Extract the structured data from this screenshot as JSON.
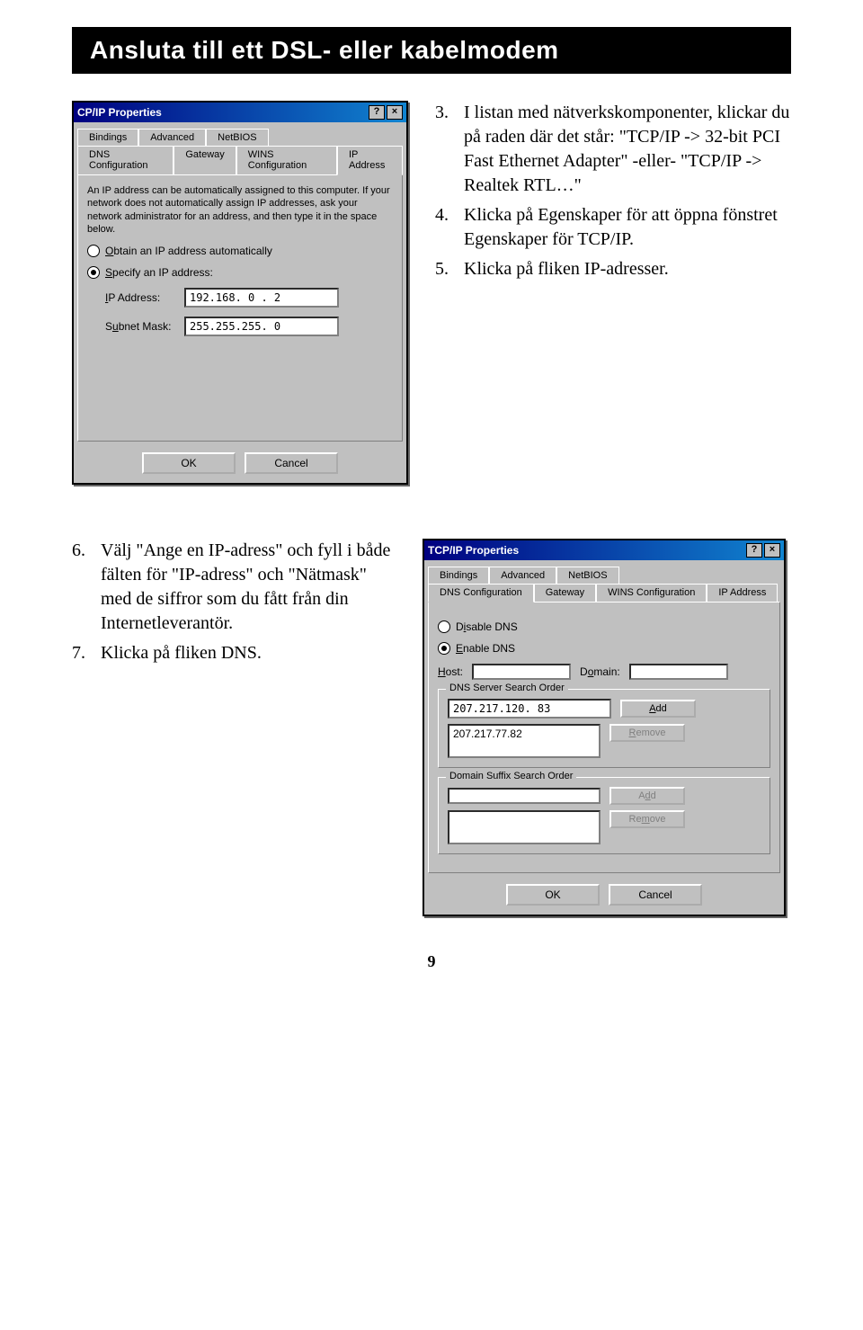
{
  "header": {
    "title": "Ansluta till ett DSL- eller kabelmodem"
  },
  "dialog1": {
    "title": "CP/IP Properties",
    "tabs_top": [
      "Bindings",
      "Advanced",
      "NetBIOS"
    ],
    "tabs_bottom": [
      "DNS Configuration",
      "Gateway",
      "WINS Configuration",
      "IP Address"
    ],
    "help_text": "An IP address can be automatically assigned to this computer. If your network does not automatically assign IP addresses, ask your network administrator for an address, and then type it in the space below.",
    "radio_obtain": "Obtain an IP address automatically",
    "radio_specify": "Specify an IP address:",
    "ip_label": "IP Address:",
    "ip_value": "192.168. 0 . 2",
    "mask_label": "Subnet Mask:",
    "mask_value": "255.255.255. 0",
    "ok": "OK",
    "cancel": "Cancel"
  },
  "instructions1": {
    "items": [
      {
        "n": "3.",
        "text": "I listan med nätverkskomponenter, klickar du på raden där det står: \"TCP/IP -> 32-bit PCI Fast Ethernet Adapter\" -eller- \"TCP/IP -> Realtek RTL…\""
      },
      {
        "n": "4.",
        "text": "Klicka på Egenskaper för att öppna fönstret Egenskaper för TCP/IP."
      },
      {
        "n": "5.",
        "text": "Klicka på fliken IP-adresser."
      }
    ]
  },
  "instructions2": {
    "items": [
      {
        "n": "6.",
        "text": "Välj \"Ange en IP-adress\" och fyll i både fälten för \"IP-adress\" och \"Nätmask\" med de siffror som du fått från din Internetleverantör."
      },
      {
        "n": "7.",
        "text": "Klicka på fliken DNS."
      }
    ]
  },
  "dialog2": {
    "title": "TCP/IP Properties",
    "tabs_top": [
      "Bindings",
      "Advanced",
      "NetBIOS"
    ],
    "tabs_bottom": [
      "DNS Configuration",
      "Gateway",
      "WINS Configuration",
      "IP Address"
    ],
    "radio_disable": "Disable DNS",
    "radio_enable": "Enable DNS",
    "host_label": "Host:",
    "domain_label": "Domain:",
    "group1_title": "DNS Server Search Order",
    "ip_entry": "207.217.120. 83",
    "list_item": "207.217.77.82",
    "add": "Add",
    "remove": "Remove",
    "group2_title": "Domain Suffix Search Order",
    "ok": "OK",
    "cancel": "Cancel"
  },
  "page_number": "9"
}
